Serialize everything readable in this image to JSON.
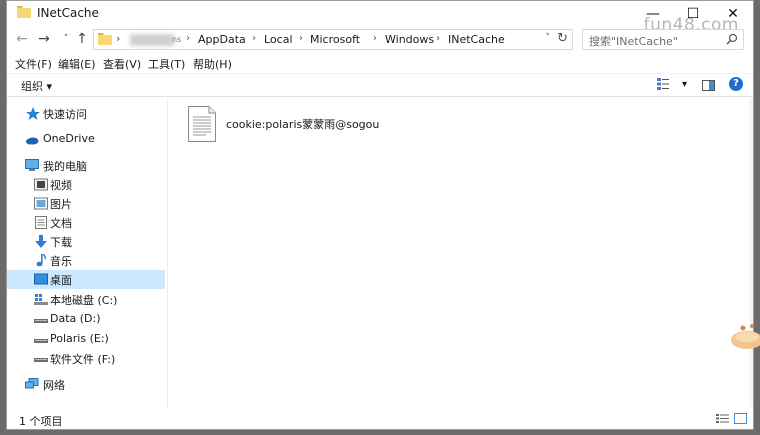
{
  "window": {
    "title": "INetCache",
    "min": "—",
    "max": "☐",
    "close": "✕",
    "watermark": "fun48.com"
  },
  "nav": {
    "back": "←",
    "forward": "→",
    "recent": "˅",
    "up": "↑"
  },
  "address": {
    "sep": "›",
    "partial": "ns",
    "crumbs": [
      "AppData",
      "Local",
      "Microsoft",
      "Windows",
      "INetCache"
    ],
    "dropdown": "˅",
    "refresh": "↻"
  },
  "search": {
    "placeholder": "搜索\"INetCache\""
  },
  "menu": [
    "文件(F)",
    "编辑(E)",
    "查看(V)",
    "工具(T)",
    "帮助(H)"
  ],
  "toolbar": {
    "organize": "组织 ▾",
    "view_dd": "▾",
    "help": "?"
  },
  "sidebar": {
    "quick_access": "快速访问",
    "onedrive": "OneDrive",
    "this_pc": "我的电脑",
    "videos": "视频",
    "pictures": "图片",
    "documents": "文档",
    "downloads": "下载",
    "music": "音乐",
    "desktop": "桌面",
    "drive_c": "本地磁盘 (C:)",
    "drive_d": "Data (D:)",
    "drive_e": "Polaris (E:)",
    "drive_f": "软件文件 (F:)",
    "network": "网络"
  },
  "files": [
    {
      "name": "cookie:polaris蒙蒙雨@sogou"
    }
  ],
  "status": {
    "count": "1 个项目"
  },
  "colors": {
    "selected": "#cce8ff",
    "folder": "#f8d775",
    "accent": "#0078d7"
  }
}
